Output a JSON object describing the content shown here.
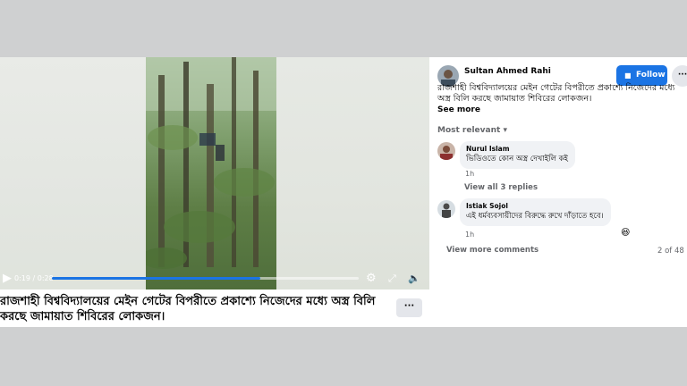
{
  "video": {
    "time": "0:19 / 0:28",
    "progress_fraction": 0.678,
    "caption": "রাজশাহী বিশ্ববিদ্যালয়ের মেইন গেটের বিপরীতে প্রকাশ্যে নিজেদের মধ্যে অস্ত্র বিলি করছে জামায়াত শিবিরের লোকজন।",
    "more_label": "···"
  },
  "post": {
    "author": "Sultan Ahmed Rahi",
    "follow_label": "Follow",
    "more_label": "···",
    "text": "রাজশাহী বিশ্ববিদ্যালয়ের মেইন গেটের বিপরীতে প্রকাশ্যে নিজেদের মধ্যে অস্ত্র বিলি করছে জামায়াত শিবিরের লোকজন।",
    "see_more": "See more"
  },
  "comments_header": {
    "sort_label": "Most relevant",
    "sort_icon": "▾"
  },
  "comments": [
    {
      "author": "Nurul Islam",
      "text": "ভিডিওতে কোন অস্ত্র দেখাইলি কই",
      "time": "1h",
      "replies_label": "View all 3 replies"
    },
    {
      "author": "Istiak Sojol",
      "text": "এই ধর্মব্যবসায়ীদের বিরুদ্ধে রুখে দাঁড়াতে হবে।",
      "time": "1h",
      "reaction": "😆"
    }
  ],
  "footer": {
    "view_more": "View more comments",
    "count": "2 of 48"
  },
  "colors": {
    "accent": "#1b74e4",
    "bubble": "#f0f2f5",
    "muted": "#65676b"
  }
}
